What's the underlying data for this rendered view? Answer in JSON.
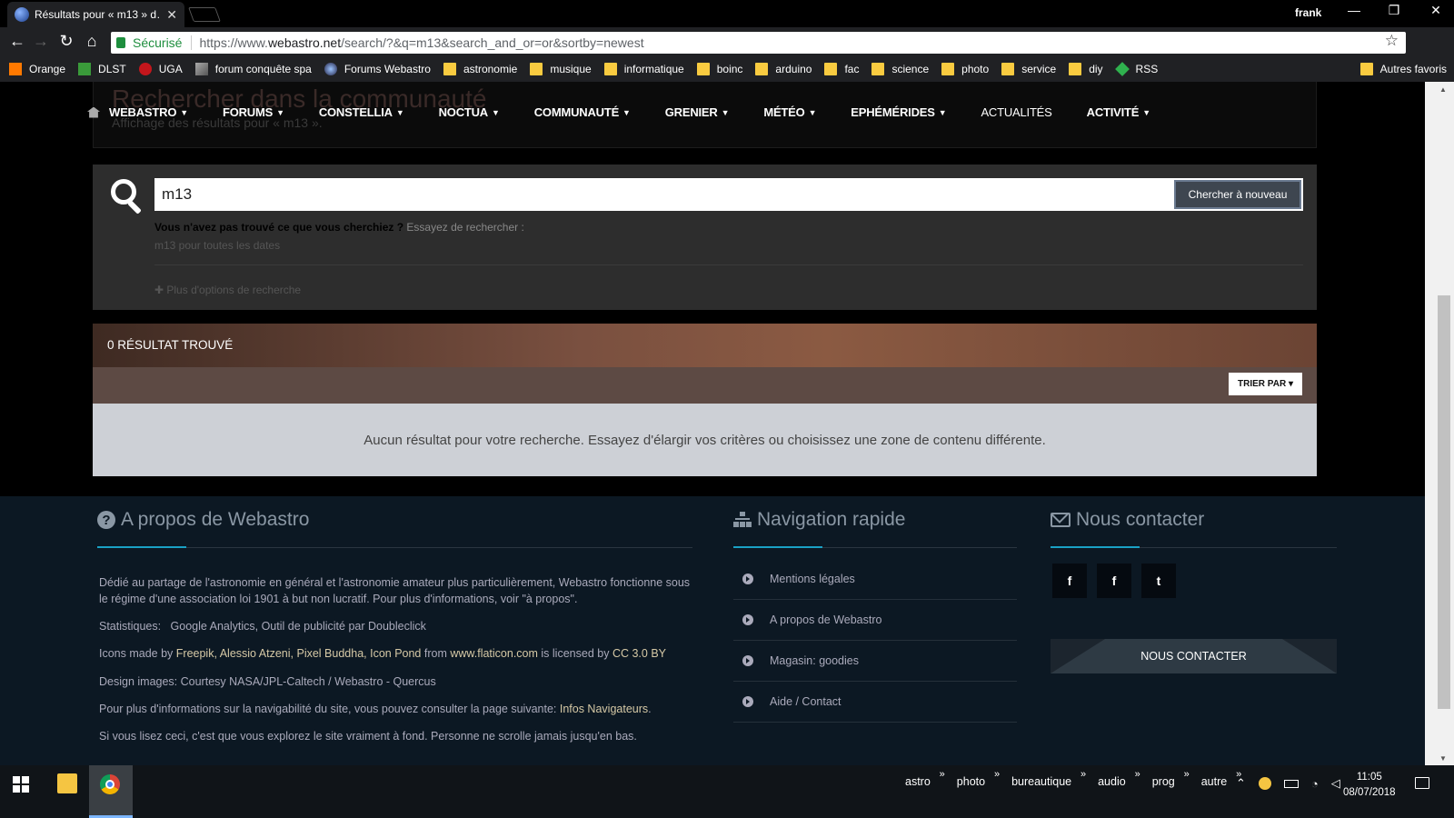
{
  "browser": {
    "tab_title": "Résultats pour « m13 » d…",
    "profile": "frank",
    "secure_label": "Sécurisé",
    "url_prefix": "https://www.",
    "url_domain": "webastro.net",
    "url_path": "/search/?&q=m13&search_and_or=or&sortby=newest"
  },
  "bookmarks": [
    {
      "label": "Orange",
      "icon": "orange-icon"
    },
    {
      "label": "DLST",
      "icon": "dlst-icon"
    },
    {
      "label": "UGA",
      "icon": "uga-icon"
    },
    {
      "label": "forum conquête spa",
      "icon": "image-icon"
    },
    {
      "label": "Forums Webastro",
      "icon": "webastro-icon"
    },
    {
      "label": "astronomie",
      "icon": "folder-icon"
    },
    {
      "label": "musique",
      "icon": "folder-icon"
    },
    {
      "label": "informatique",
      "icon": "folder-icon"
    },
    {
      "label": "boinc",
      "icon": "folder-icon"
    },
    {
      "label": "arduino",
      "icon": "folder-icon"
    },
    {
      "label": "fac",
      "icon": "folder-icon"
    },
    {
      "label": "science",
      "icon": "folder-icon"
    },
    {
      "label": "photo",
      "icon": "folder-icon"
    },
    {
      "label": "service",
      "icon": "folder-icon"
    },
    {
      "label": "diy",
      "icon": "folder-icon"
    },
    {
      "label": "RSS",
      "icon": "rss-icon"
    }
  ],
  "bookmarks_other": "Autres favoris",
  "header": {
    "heading": "Rechercher dans la communauté",
    "subheading": "Affichage des résultats pour « m13 »."
  },
  "nav": [
    {
      "label": "WEBASTRO",
      "caret": true
    },
    {
      "label": "FORUMS",
      "caret": true
    },
    {
      "label": "CONSTELLIA",
      "caret": true
    },
    {
      "label": "NOCTUA",
      "caret": true
    },
    {
      "label": "COMMUNAUTÉ",
      "caret": true
    },
    {
      "label": "GRENIER",
      "caret": true
    },
    {
      "label": "MÉTÉO",
      "caret": true
    },
    {
      "label": "EPHÉMÉRIDES",
      "caret": true
    },
    {
      "label": "ACTUALITÉS",
      "caret": false
    },
    {
      "label": "ACTIVITÉ",
      "caret": true
    }
  ],
  "search": {
    "query": "m13",
    "button": "Chercher à nouveau",
    "notfound_bold": "Vous n'avez pas trouvé ce que vous cherchiez ?",
    "notfound_rest": "Essayez de rechercher :",
    "suggestion": "m13 pour toutes les dates",
    "more_options": "Plus d'options de recherche"
  },
  "results": {
    "count_label": "0 RÉSULTAT TROUVÉ",
    "sort_label": "TRIER PAR",
    "empty_message": "Aucun résultat pour votre recherche. Essayez d'élargir vos critères ou choisissez une zone de contenu différente."
  },
  "footer": {
    "about_title": "A propos de Webastro",
    "about_text": "Dédié au partage de l'astronomie en général et l'astronomie amateur plus particulièrement, Webastro fonctionne sous le régime d'une association loi 1901 à but non lucratif. Pour plus d'informations, voir \"à propos\".",
    "stats_label": "Statistiques:",
    "stats_value": "Google Analytics, Outil de publicité par Doubleclick",
    "icons_prefix": "Icons made by",
    "icons_authors": "Freepik, Alessio Atzeni, Pixel Buddha, Icon Pond",
    "icons_from": "from",
    "icons_site": "www.flaticon.com",
    "icons_license_prefix": "is licensed by",
    "icons_license": "CC 3.0 BY",
    "design_images": "Design images: Courtesy NASA/JPL-Caltech / Webastro - Quercus",
    "nav_info_prefix": "Pour plus d'informations sur la navigabilité du site, vous pouvez consulter la page suivante:",
    "nav_info_link": "Infos Navigateurs",
    "nav_info_suffix": ".",
    "easter": "Si vous lisez ceci, c'est que vous explorez le site vraiment à fond. Personne ne scrolle jamais jusqu'en bas.",
    "nav_title": "Navigation rapide",
    "nav_links": [
      "Mentions légales",
      "A propos de Webastro",
      "Magasin: goodies",
      "Aide / Contact"
    ],
    "contact_title": "Nous contacter",
    "social": [
      "f",
      "f",
      "t"
    ],
    "contact_button": "NOUS CONTACTER"
  },
  "taskbar": {
    "quicklinks": [
      "astro",
      "photo",
      "bureautique",
      "audio",
      "prog",
      "autre"
    ],
    "time": "11:05",
    "date": "08/07/2018"
  }
}
